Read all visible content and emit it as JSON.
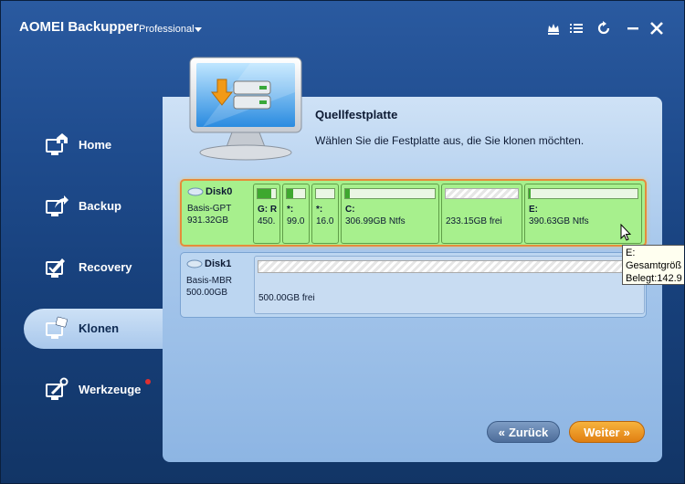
{
  "app": {
    "name": "AOMEI Backupper",
    "edition": "Professional"
  },
  "titlebar_icons": [
    "crown-icon",
    "menu-list-icon",
    "refresh-icon",
    "minimize-icon",
    "close-icon"
  ],
  "sidebar": {
    "items": [
      {
        "label": "Home",
        "icon": "home-icon",
        "active": false
      },
      {
        "label": "Backup",
        "icon": "backup-icon",
        "active": false
      },
      {
        "label": "Recovery",
        "icon": "recovery-icon",
        "active": false
      },
      {
        "label": "Klonen",
        "icon": "clone-icon",
        "active": true
      },
      {
        "label": "Werkzeuge",
        "icon": "tools-icon",
        "active": false,
        "badge": true
      }
    ]
  },
  "main": {
    "title": "Quellfestplatte",
    "subtitle": "Wählen Sie die Festplatte aus, die Sie klonen möchten."
  },
  "disks": [
    {
      "name": "Disk0",
      "type": "Basis-GPT",
      "size": "931.32GB",
      "selected": true,
      "partitions": [
        {
          "label": "G: R",
          "info": "450.",
          "used_fraction": 0.75,
          "striped": false
        },
        {
          "label": "*:",
          "info": "99.0",
          "used_fraction": 0.35,
          "striped": false
        },
        {
          "label": "*:",
          "info": "16.0",
          "used_fraction": 0.0,
          "striped": false
        },
        {
          "label": "C:",
          "info": "306.99GB Ntfs",
          "used_fraction": 0.05,
          "striped": false
        },
        {
          "label": "",
          "info": "233.15GB frei",
          "used_fraction": 0.0,
          "striped": true
        },
        {
          "label": "E:",
          "info": "390.63GB Ntfs",
          "used_fraction": 0.02,
          "striped": false
        }
      ]
    },
    {
      "name": "Disk1",
      "type": "Basis-MBR",
      "size": "500.00GB",
      "selected": false,
      "unallocated": "500.00GB frei"
    }
  ],
  "tooltip": {
    "line1": "E:",
    "line2": "Gesamtgröß",
    "line3": "Belegt:142.9"
  },
  "buttons": {
    "back": "Zurück",
    "next": "Weiter"
  },
  "colors": {
    "accent_orange": "#e58c3b",
    "partition_green": "#a7f08d",
    "window_blue": "#1f4c8e"
  }
}
